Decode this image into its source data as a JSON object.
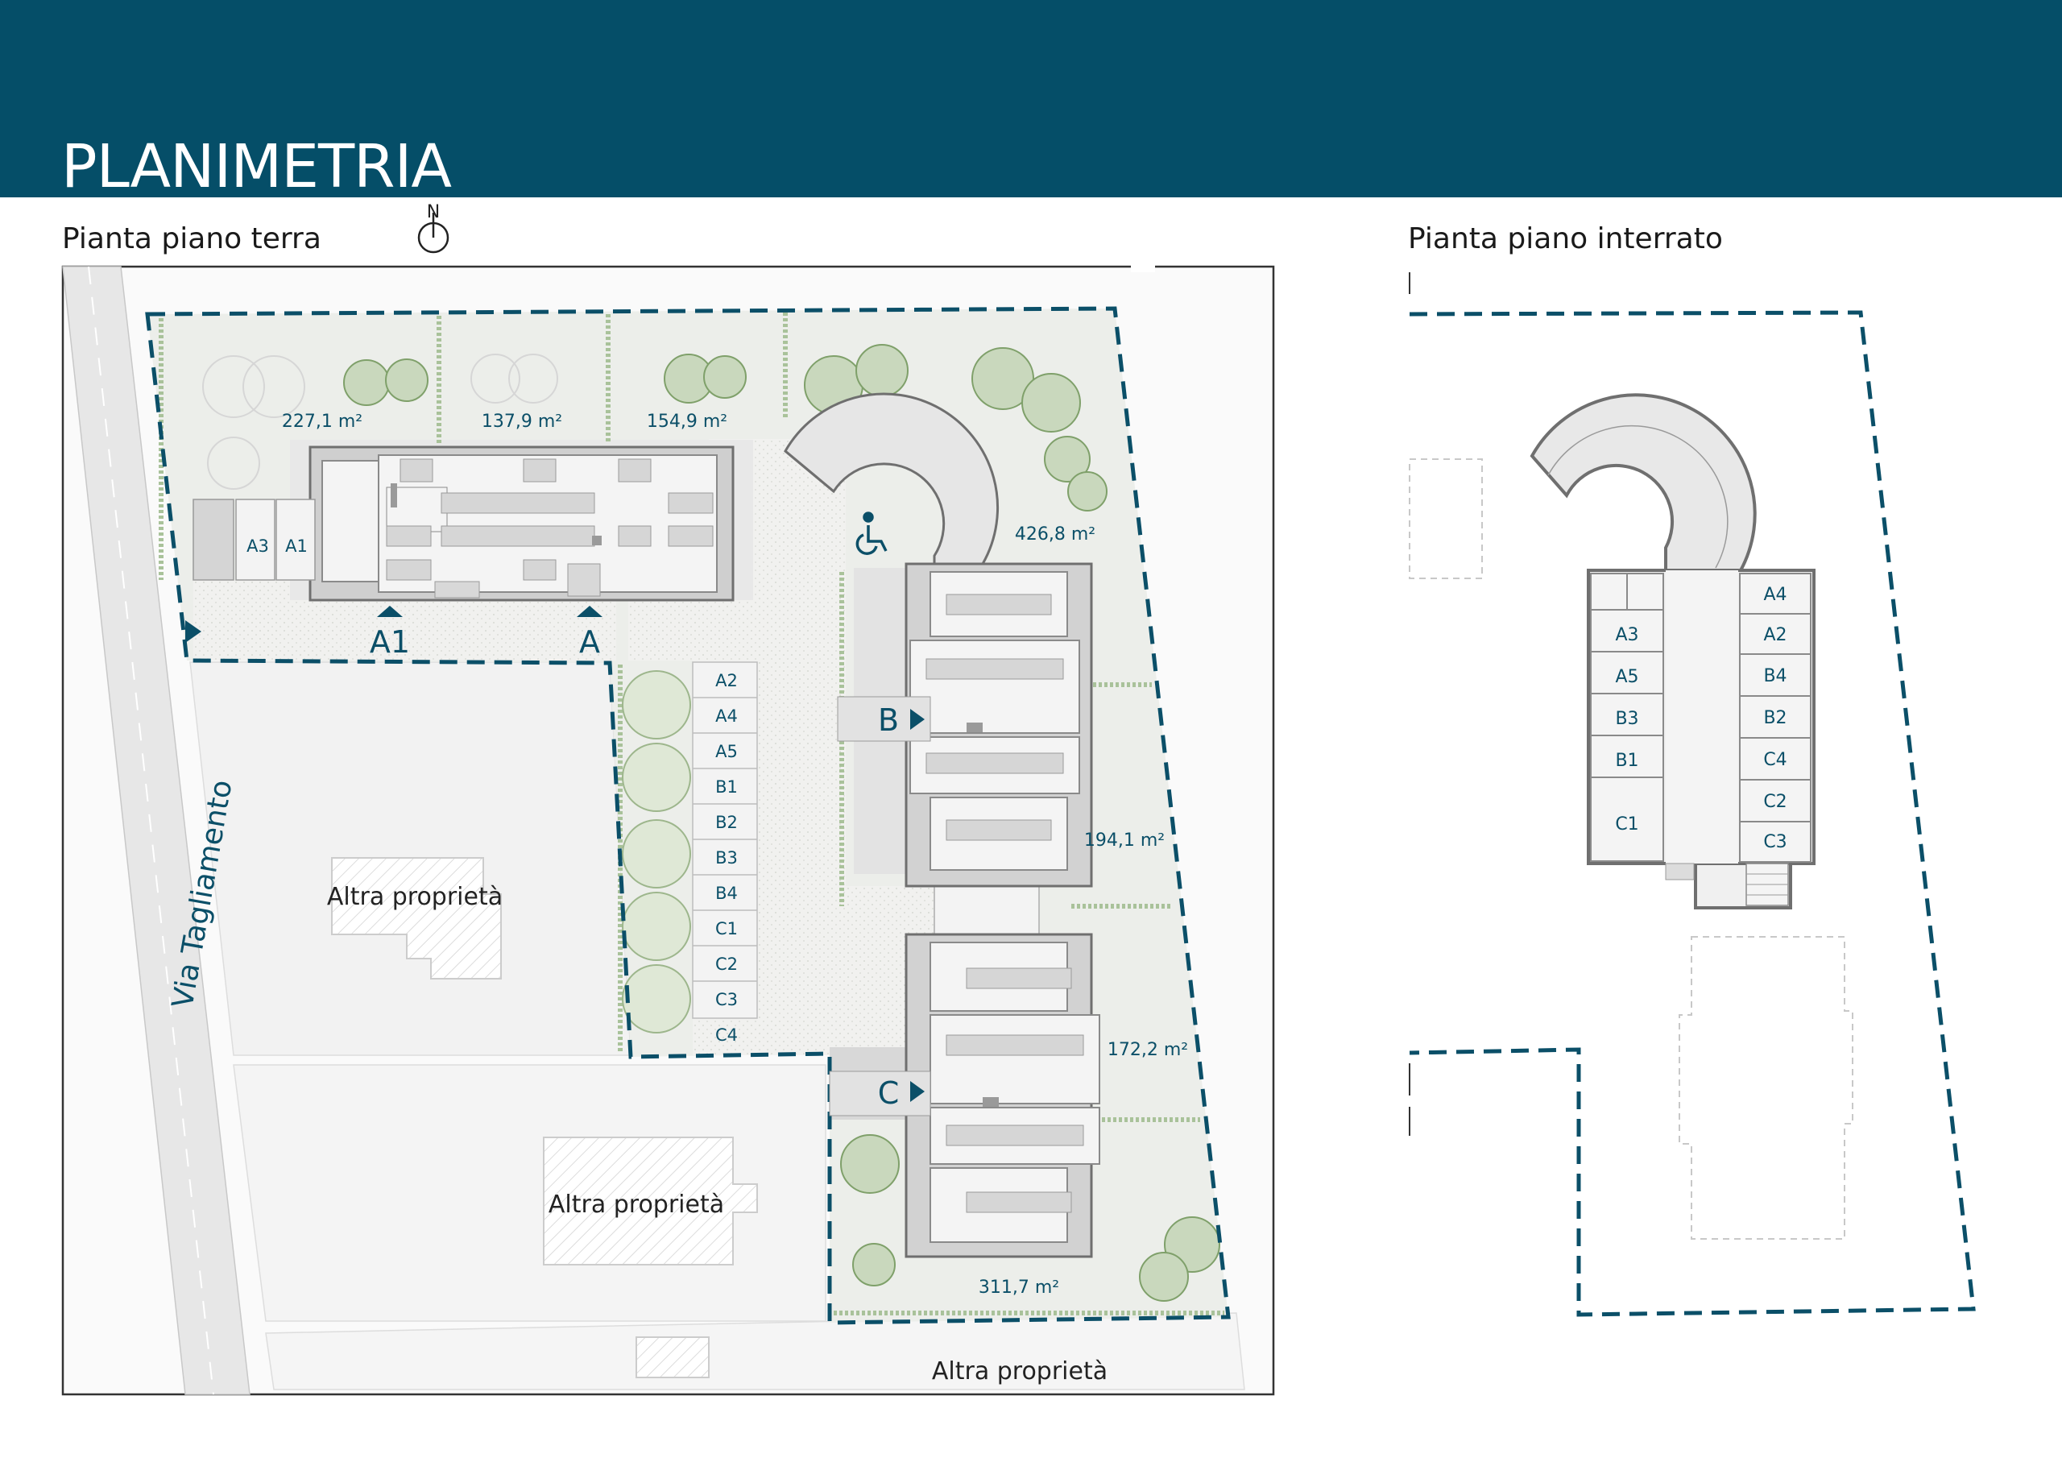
{
  "page": {
    "title": "PLANIMETRIA",
    "ground_floor_title": "Pianta piano terra",
    "basement_title": "Pianta piano interrato",
    "north_label": "N"
  },
  "colors": {
    "header": "#054e68",
    "accent": "#0b4f68",
    "garden": "#eceeea",
    "paving": "#f0f0ee",
    "building": "#dadada"
  },
  "ground_floor": {
    "street": "Via Tagliamento",
    "other_property_1": "Altra proprietà",
    "other_property_2": "Altra proprietà",
    "other_property_3": "Altra proprietà",
    "accessible_icon": "wheelchair-icon",
    "gardens": {
      "g1": "227,1 m²",
      "g2": "137,9 m²",
      "g3": "154,9 m²",
      "g4": "426,8 m²",
      "g5": "194,1 m²",
      "g6": "172,2 m²",
      "g7": "311,7 m²"
    },
    "entrances": {
      "a1": "A1",
      "a": "A",
      "b": "B",
      "c": "C"
    },
    "small_spaces": [
      "A3",
      "A1"
    ],
    "parking": [
      "A2",
      "A4",
      "A5",
      "B1",
      "B2",
      "B3",
      "B4",
      "C1",
      "C2",
      "C3",
      "C4"
    ]
  },
  "basement": {
    "left_units": [
      "A3",
      "A5",
      "B3",
      "B1",
      "C1"
    ],
    "right_units": [
      "A4",
      "A2",
      "B4",
      "B2",
      "C4",
      "C2",
      "C3"
    ]
  }
}
